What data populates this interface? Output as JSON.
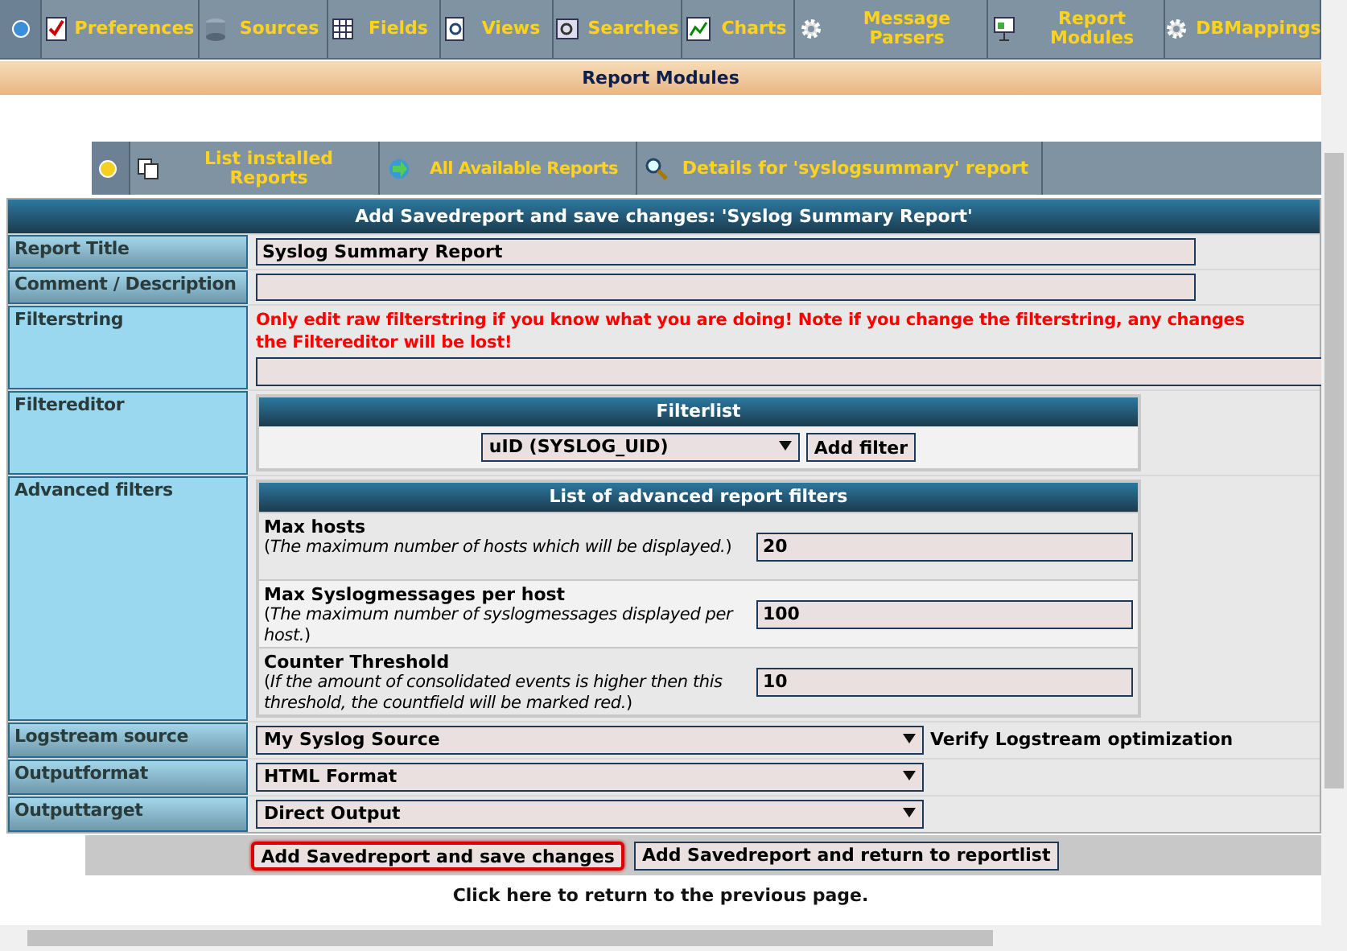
{
  "nav": [
    {
      "selected": true
    },
    {
      "label": "Preferences",
      "selected": false
    },
    {
      "label": "Sources",
      "selected": false
    },
    {
      "label": "Fields",
      "selected": false
    },
    {
      "label": "Views",
      "selected": false
    },
    {
      "label": "Searches",
      "selected": false
    },
    {
      "label": "Charts",
      "selected": false
    },
    {
      "label": "Message Parsers",
      "selected": false
    },
    {
      "label": "Report Modules",
      "selected": false
    },
    {
      "label": "DBMappings",
      "selected": false
    }
  ],
  "section_title": "Report Modules",
  "sub_tabs": [
    {
      "selected": true
    },
    {
      "label": "List installed Reports",
      "selected": false
    },
    {
      "label": "All Available Reports",
      "selected": false
    },
    {
      "label": "Details for 'syslogsummary' report",
      "selected": false
    }
  ],
  "form": {
    "title": "Add Savedreport and save changes: 'Syslog Summary Report'",
    "rows": [
      {
        "kind": "text",
        "label": "Report Title",
        "value": "Syslog Summary Report"
      },
      {
        "kind": "text",
        "label": "Comment / Description"
      },
      {
        "kind": "filterstring",
        "label": "Filterstring",
        "warning": [
          "Only edit raw filterstring if you know what you are doing! Note if you change the filterstring, any changes",
          "the Filtereditor will be lost!"
        ]
      },
      {
        "kind": "filtereditor",
        "label": "Filtereditor",
        "header": "Filterlist",
        "select": "uID (SYSLOG_UID)",
        "button": "Add filter"
      },
      {
        "kind": "advanced",
        "label": "Advanced filters",
        "header": "List of advanced report filters",
        "items": [
          {
            "name": "Max hosts",
            "description": "(*The maximum number of hosts which will be displayed.*)",
            "value": "20"
          },
          {
            "name": "Max Syslogmessages per host",
            "description": "(*The maximum number of syslogmessages displayed per host.*)",
            "value": "100"
          },
          {
            "name": "Counter Threshold",
            "description": "(*If the amount of consolidated events is higher then this threshold, the countfield will be marked red.*)",
            "value": "10"
          }
        ]
      },
      {
        "kind": "select",
        "label": "Logstream source",
        "value": "My Syslog Source",
        "note": "Verify Logstream optimization"
      },
      {
        "kind": "select",
        "label": "Outputformat",
        "value": "HTML Format"
      },
      {
        "kind": "select",
        "label": "Outputtarget",
        "value": "Direct Output"
      }
    ]
  },
  "buttons": [
    {
      "label": "Add Savedreport and save changes",
      "highlighted": true
    },
    {
      "label": "Add Savedreport and return to reportlist",
      "highlighted": false
    }
  ],
  "back_link": "Click here to return to the previous page."
}
